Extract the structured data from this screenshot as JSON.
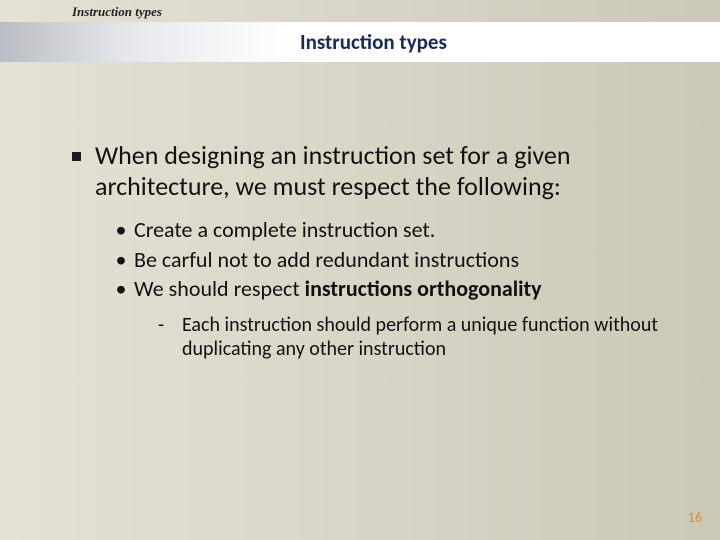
{
  "header": {
    "label": "Instruction types",
    "title": "Instruction types"
  },
  "content": {
    "main_point": "When designing an instruction set for a given architecture, we must respect the following:",
    "sub_points": [
      " Create a complete instruction set.",
      "Be carful not to add redundant instructions",
      "We should respect "
    ],
    "sub_point_bold": "instructions orthogonality",
    "detail": "Each instruction should perform a unique function without duplicating any other instruction"
  },
  "page_number": "16"
}
